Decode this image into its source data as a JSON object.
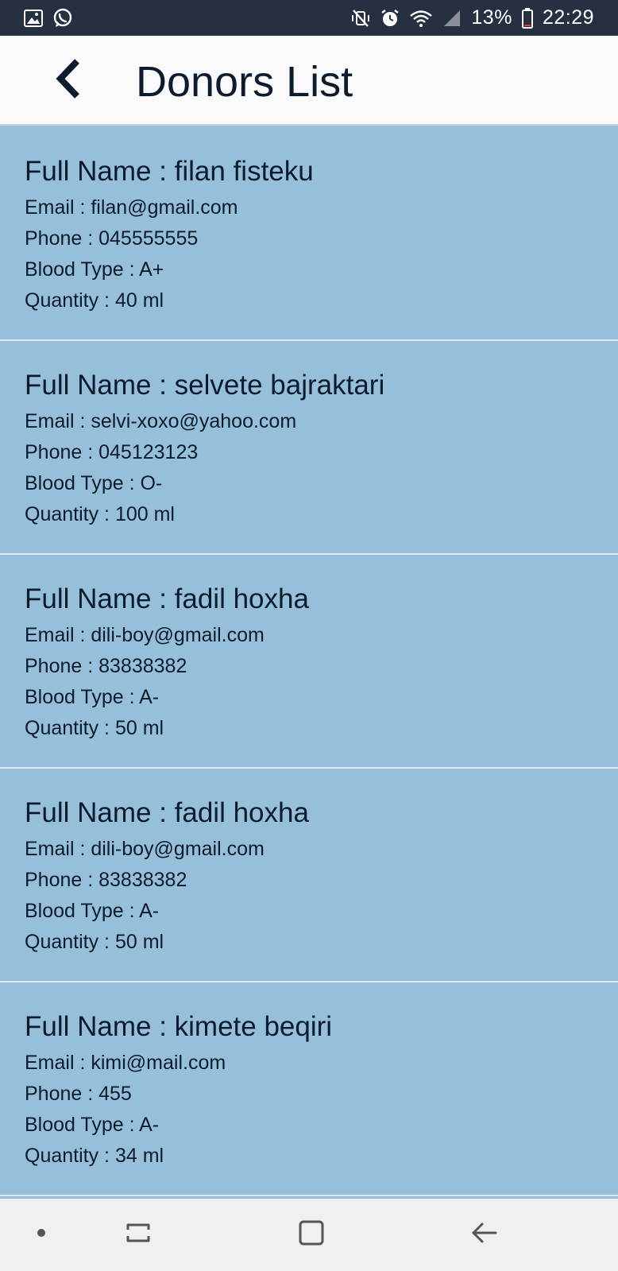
{
  "status_bar": {
    "battery": "13%",
    "time": "22:29",
    "left_icons": [
      "gallery-icon",
      "whatsapp-icon"
    ],
    "right_icons": [
      "mute-vibrate-icon",
      "alarm-icon",
      "wifi-icon",
      "signal-icon",
      "battery-icon"
    ]
  },
  "header": {
    "title": "Donors List",
    "back_icon": "chevron-left-icon"
  },
  "donors": [
    {
      "name": "Full Name : filan fisteku",
      "email": "Email : filan@gmail.com",
      "phone": "Phone : 045555555",
      "blood_type": "Blood Type : A+",
      "quantity": "Quantity : 40 ml"
    },
    {
      "name": "Full Name : selvete bajraktari",
      "email": "Email : selvi-xoxo@yahoo.com",
      "phone": "Phone : 045123123",
      "blood_type": "Blood Type : O-",
      "quantity": "Quantity : 100 ml"
    },
    {
      "name": "Full Name : fadil hoxha",
      "email": "Email : dili-boy@gmail.com",
      "phone": "Phone : 83838382",
      "blood_type": "Blood Type : A-",
      "quantity": "Quantity : 50 ml"
    },
    {
      "name": "Full Name : fadil hoxha",
      "email": "Email : dili-boy@gmail.com",
      "phone": "Phone : 83838382",
      "blood_type": "Blood Type : A-",
      "quantity": "Quantity : 50 ml"
    },
    {
      "name": "Full Name : kimete beqiri",
      "email": "Email : kimi@mail.com",
      "phone": "Phone : 455",
      "blood_type": "Blood Type : A-",
      "quantity": "Quantity : 34 ml"
    }
  ],
  "nav_bar": {
    "icons": [
      "nav-dot-icon",
      "recent-apps-icon",
      "home-icon",
      "back-arrow-icon"
    ]
  },
  "colors": {
    "status_bar_bg": "#263040",
    "app_bar_bg": "#fafafa",
    "list_bg": "#96bfd9",
    "text": "#0d1b2e",
    "nav_bar_bg": "#f0f0f2"
  }
}
